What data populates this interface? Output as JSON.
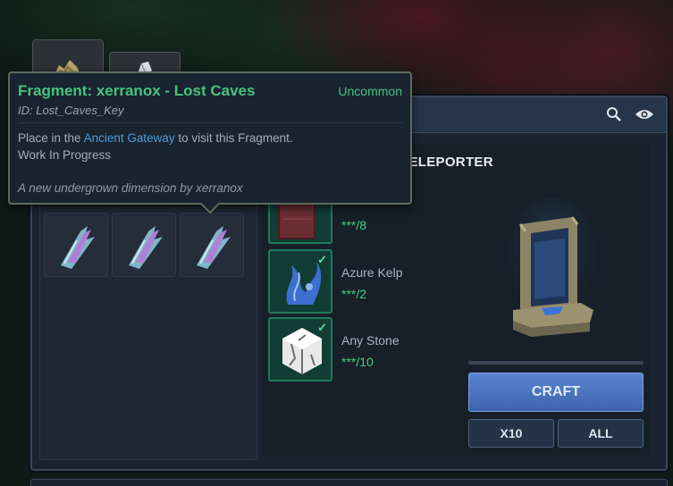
{
  "tooltip": {
    "title": "Fragment: xerranox - Lost Caves",
    "rarity": "Uncommon",
    "id_text": "ID: Lost_Caves_Key",
    "desc_prefix": "Place in the ",
    "desc_link": "Ancient Gateway",
    "desc_suffix": " to visit this Fragment.",
    "desc_line2": "Work In Progress",
    "footer": "A new undergrown dimension by xerranox"
  },
  "recipe": {
    "title_fragment": "TELEPORTER",
    "ingredients": [
      {
        "name": "",
        "count": "***/8",
        "icon": "netherrack-block-icon",
        "checked": false
      },
      {
        "name": "Azure Kelp",
        "count": "***/2",
        "icon": "azure-kelp-icon",
        "checked": true
      },
      {
        "name": "Any Stone",
        "count": "***/10",
        "icon": "stone-block-icon",
        "checked": true
      }
    ],
    "result_icon": "teleporter-gateway-icon"
  },
  "buttons": {
    "craft": "CRAFT",
    "x10": "X10",
    "all": "ALL"
  },
  "header_icons": [
    "search-icon",
    "eye-icon"
  ],
  "colors": {
    "rarity_uncommon": "#46c37c",
    "link": "#4e9bd6",
    "count_ok": "#3fd07d",
    "craft_button": "#4a70bb"
  }
}
